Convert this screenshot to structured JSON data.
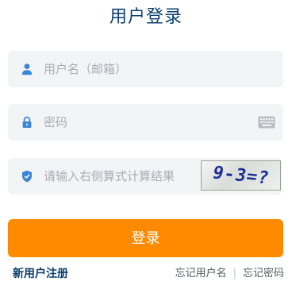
{
  "title": "用户登录",
  "fields": {
    "username_placeholder": "用户名（邮箱）",
    "password_placeholder": "密码",
    "captcha_placeholder": "请输入右侧算式计算结果"
  },
  "captcha_text": "9-3=?",
  "login_label": "登录",
  "register_label": "新用户注册",
  "forgot_username_label": "忘记用户名",
  "separator": "|",
  "forgot_password_label": "忘记密码",
  "colors": {
    "title": "#0c3f72",
    "accent_button": "#ff8a00",
    "icon_blue": "#3a86d8",
    "field_bg": "#f3f4f6"
  },
  "icons": [
    "user-icon",
    "lock-icon",
    "keyboard-icon",
    "shield-icon"
  ]
}
